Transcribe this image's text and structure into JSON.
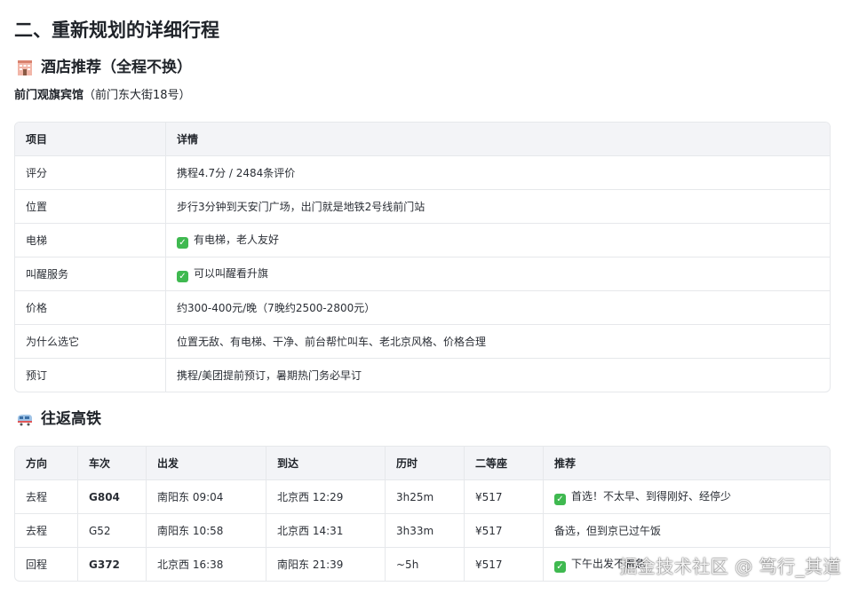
{
  "section_title": "二、重新规划的详细行程",
  "hotel": {
    "heading": "酒店推荐（全程不换）",
    "icon": "hotel-icon",
    "name": "前门观旗宾馆",
    "address": "（前门东大街18号）",
    "table": {
      "headers": [
        "项目",
        "详情"
      ],
      "rows": [
        {
          "item": "评分",
          "detail": "携程4.7分 / 2484条评价",
          "check": false
        },
        {
          "item": "位置",
          "detail": "步行3分钟到天安门广场，出门就是地铁2号线前门站",
          "check": false
        },
        {
          "item": "电梯",
          "detail": "有电梯，老人友好",
          "check": true
        },
        {
          "item": "叫醒服务",
          "detail": "可以叫醒看升旗",
          "check": true
        },
        {
          "item": "价格",
          "detail": "约300-400元/晚（7晚约2500-2800元）",
          "check": false
        },
        {
          "item": "为什么选它",
          "detail": "位置无敌、有电梯、干净、前台帮忙叫车、老北京风格、价格合理",
          "check": false
        },
        {
          "item": "预订",
          "detail": "携程/美团提前预订，暑期热门务必早订",
          "check": false
        }
      ]
    }
  },
  "train": {
    "heading": "往返高铁",
    "icon": "train-icon",
    "table": {
      "headers": [
        "方向",
        "车次",
        "出发",
        "到达",
        "历时",
        "二等座",
        "推荐"
      ],
      "rows": [
        {
          "direction": "去程",
          "train": "G804",
          "bold": true,
          "depart": "南阳东 09:04",
          "arrive": "北京西 12:29",
          "duration": "3h25m",
          "price": "¥517",
          "note": "首选！不太早、到得刚好、经停少",
          "check": true
        },
        {
          "direction": "去程",
          "train": "G52",
          "bold": false,
          "depart": "南阳东 10:58",
          "arrive": "北京西 14:31",
          "duration": "3h33m",
          "price": "¥517",
          "note": "备选，但到京已过午饭",
          "check": false
        },
        {
          "direction": "回程",
          "train": "G372",
          "bold": true,
          "depart": "北京西 16:38",
          "arrive": "南阳东 21:39",
          "duration": "~5h",
          "price": "¥517",
          "note": "下午出发不着急",
          "check": true
        }
      ]
    }
  },
  "watermark": "掘金技术社区 @ 笃行_其道",
  "colors": {
    "header_bg": "#f3f4f7",
    "border": "#e6e8eb",
    "check_green": "#3fb950"
  }
}
